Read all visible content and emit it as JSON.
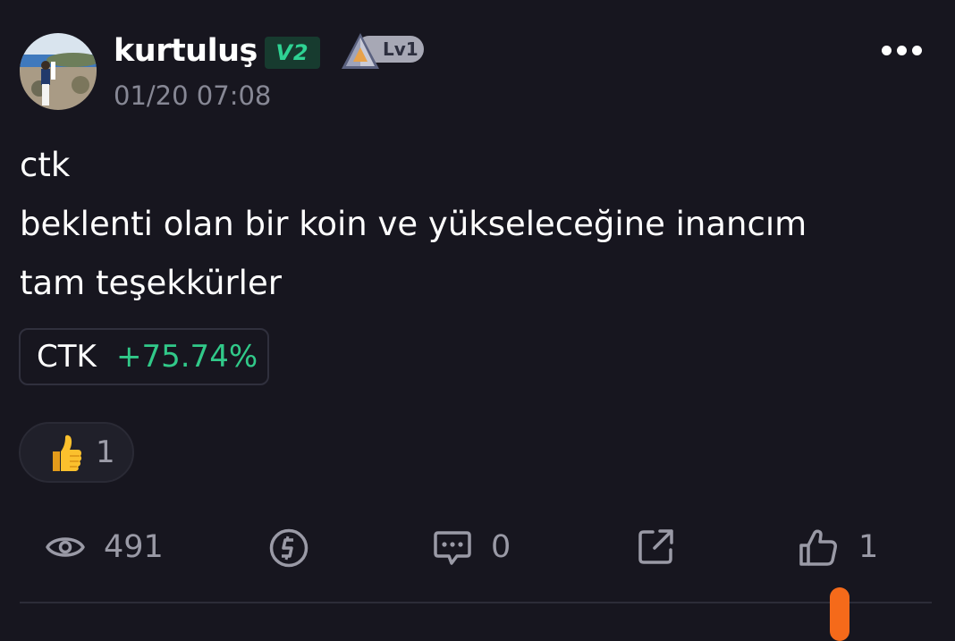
{
  "post": {
    "author": {
      "name": "kurtuluş",
      "vip_label": "V2",
      "level_label": "Lv1"
    },
    "timestamp": "01/20 07:08",
    "content_lines": [
      "ctk",
      "beklenti olan bir koin ve yükseleceğine inancım",
      "tam teşekkürler"
    ],
    "coin": {
      "symbol": "CTK",
      "change": "+75.74%"
    },
    "reaction": {
      "icon": "thumbs-up-emoji",
      "count": "1"
    },
    "actions": {
      "views": {
        "icon": "eye-icon",
        "count": "491"
      },
      "tip": {
        "icon": "coin-tip-icon"
      },
      "comments": {
        "icon": "comment-icon",
        "count": "0"
      },
      "share": {
        "icon": "share-icon"
      },
      "likes": {
        "icon": "thumbs-up-icon",
        "count": "1"
      }
    }
  },
  "colors": {
    "background": "#17161f",
    "vip_green": "#2ed393",
    "positive_change": "#31c989",
    "muted_text": "#878895",
    "accent_orange": "#f56a1a"
  }
}
